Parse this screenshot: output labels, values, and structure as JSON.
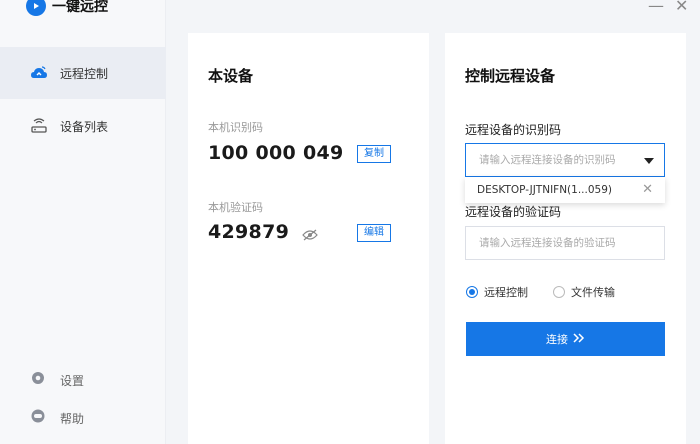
{
  "app": {
    "title": "一键远控"
  },
  "window": {
    "minimize": "—",
    "close": "✕"
  },
  "sidebar": {
    "items": [
      {
        "label": "远程控制",
        "icon": "remote-control-cloud-icon",
        "active": true
      },
      {
        "label": "设备列表",
        "icon": "device-list-icon",
        "active": false
      }
    ],
    "bottom": [
      {
        "label": "设置",
        "icon": "gear-icon"
      },
      {
        "label": "帮助",
        "icon": "help-icon"
      }
    ]
  },
  "local_device": {
    "title": "本设备",
    "id_label": "本机识别码",
    "id_value": "100 000 049",
    "copy_label": "复制",
    "code_label": "本机验证码",
    "code_value": "429879",
    "edit_label": "编辑"
  },
  "remote": {
    "title": "控制远程设备",
    "id_label": "远程设备的识别码",
    "id_placeholder": "请输入远程连接设备的识别码",
    "history_item": "DESKTOP-JJTNIFN(1...059)",
    "code_label": "远程设备的验证码",
    "code_placeholder": "请输入远程连接设备的验证码",
    "mode_remote": "远程控制",
    "mode_file": "文件传输",
    "selected_mode": "远程控制",
    "connect_label": "连接"
  },
  "colors": {
    "accent": "#1677e6",
    "background": "#f3f5f8",
    "panel": "#ffffff"
  }
}
